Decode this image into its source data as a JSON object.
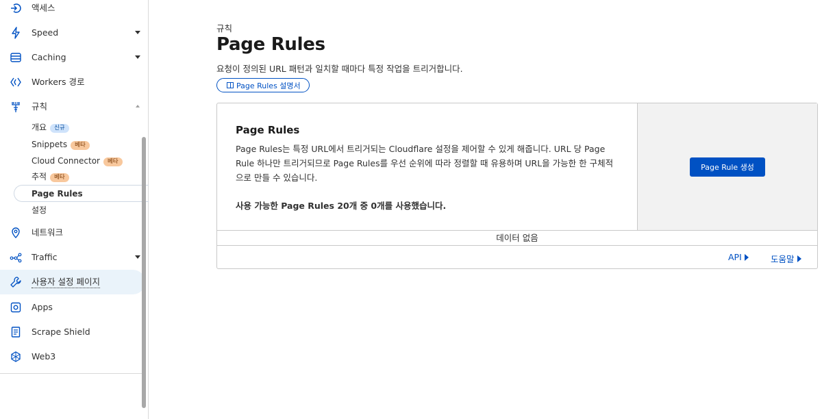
{
  "sidebar": {
    "items": [
      {
        "label": "액세스",
        "icon": "access-icon"
      },
      {
        "label": "Speed",
        "icon": "lightning-icon"
      },
      {
        "label": "Caching",
        "icon": "caching-icon"
      },
      {
        "label": "Workers 경로",
        "icon": "workers-icon"
      },
      {
        "label": "규칙",
        "icon": "rules-icon"
      },
      {
        "label": "네트워크",
        "icon": "location-pin-icon"
      },
      {
        "label": "Traffic",
        "icon": "traffic-icon"
      },
      {
        "label": "사용자 설정 페이지",
        "icon": "wrench-icon"
      },
      {
        "label": "Apps",
        "icon": "apps-icon"
      },
      {
        "label": "Scrape Shield",
        "icon": "document-icon"
      },
      {
        "label": "Web3",
        "icon": "web3-icon"
      }
    ],
    "rules_sub": [
      {
        "label": "개요",
        "badge": "신규"
      },
      {
        "label": "Snippets",
        "badge": "베타"
      },
      {
        "label": "Cloud Connector",
        "badge": "베타"
      },
      {
        "label": "추적",
        "badge": "베타"
      },
      {
        "label": "Page Rules"
      },
      {
        "label": "설정"
      }
    ]
  },
  "main": {
    "breadcrumb": "규칙",
    "title": "Page Rules",
    "description": "요청이 정의된 URL 패턴과 일치할 때마다 특정 작업을 트리거합니다.",
    "doc_link": "Page Rules 설명서",
    "card": {
      "heading": "Page Rules",
      "body": "Page Rules는 특정 URL에서 트리거되는 Cloudflare 설정을 제어할 수 있게 해줍니다. URL 당 Page Rule 하나만 트리거되므로 Page Rules를 우선 순위에 따라 정렬할 때 유용하며 URL을 가능한 한 구체적으로 만들 수 있습니다.",
      "usage": "사용 가능한 Page Rules 20개 중 0개를 사용했습니다.",
      "create_button": "Page Rule 생성",
      "no_data": "데이터 없음",
      "api_link": "API",
      "help_link": "도움말"
    }
  },
  "colors": {
    "accent": "#0051c3",
    "active_bg": "#eaf3fa",
    "badge_new": "#cfe3fb",
    "badge_beta": "#f8c89d"
  }
}
